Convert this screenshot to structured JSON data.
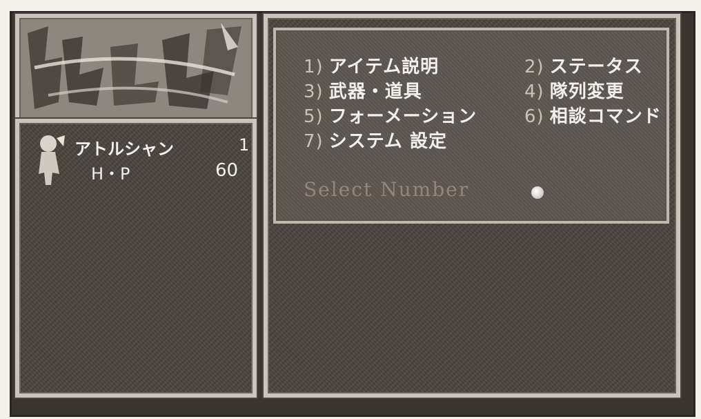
{
  "logo": {
    "text": ""
  },
  "party": {
    "members": [
      {
        "name": "アトルシャン",
        "level": "1",
        "hp_label": "H・P",
        "hp_value": "60"
      }
    ]
  },
  "menu": {
    "items": [
      {
        "num": "1)",
        "label": "アイテム説明"
      },
      {
        "num": "2)",
        "label": "ステータス"
      },
      {
        "num": "3)",
        "label": "武器・道具"
      },
      {
        "num": "4)",
        "label": "隊列変更"
      },
      {
        "num": "5)",
        "label": "フォーメーション"
      },
      {
        "num": "6)",
        "label": "相談コマンド"
      },
      {
        "num": "7)",
        "label": "システム 設定"
      }
    ],
    "prompt": "Select Number"
  },
  "colors": {
    "frame": "#c9c4bc",
    "panel": "#4a423c",
    "text": "#f4f1ea"
  }
}
